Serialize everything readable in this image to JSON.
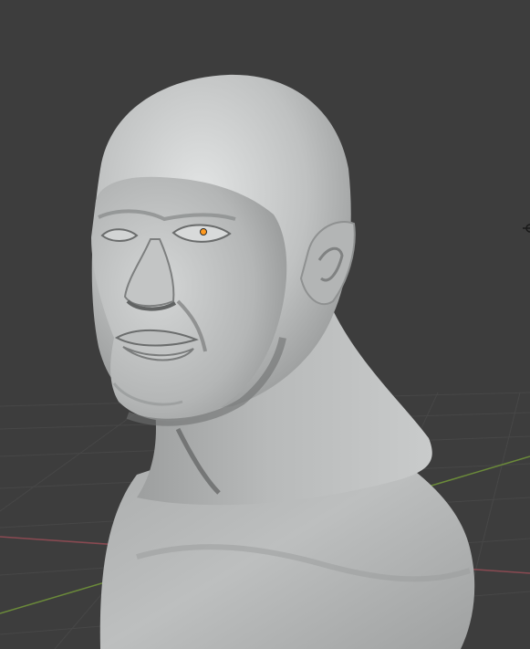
{
  "viewport": {
    "background_color": "#3d3d3d",
    "grid_color": "#474747",
    "x_axis_color": "#8a4a52",
    "y_axis_color": "#6b8a3a",
    "origin_marker_color": "#ff9a1f"
  },
  "scene": {
    "object": "sculpted-head-bust",
    "material_color": "#b9bbbb",
    "shading": "solid",
    "icons": [
      "origin-dot-icon",
      "light-gizmo-icon"
    ]
  }
}
